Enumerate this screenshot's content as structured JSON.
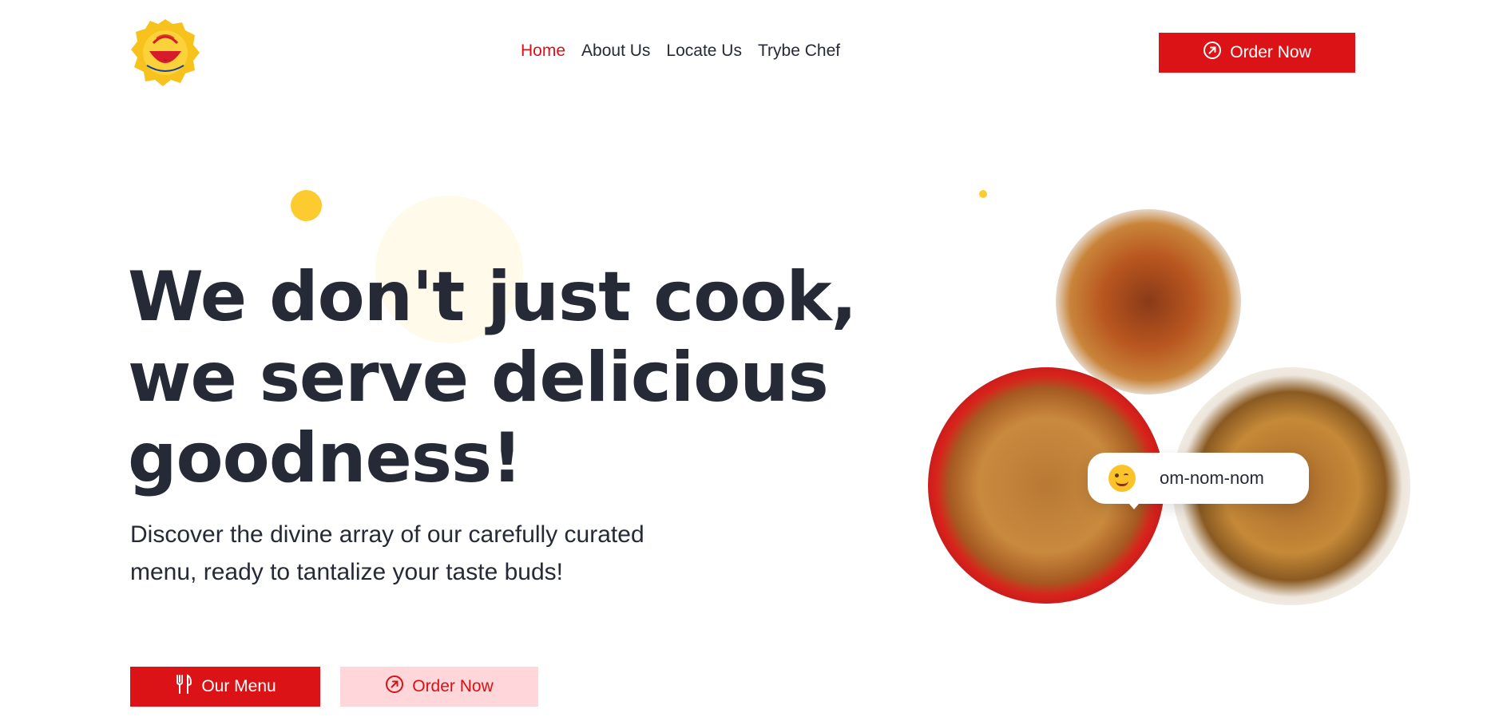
{
  "header": {
    "logo_alt": "Logo",
    "nav": [
      "Home",
      "About Us",
      "Locate Us",
      "Trybe Chef"
    ],
    "order_button": "Order Now"
  },
  "hero": {
    "headline_lines": [
      "We don't just cook,",
      "we serve delicious",
      "goodness!"
    ],
    "subtext": "Discover the divine array of our carefully curated menu, ready to tantalize your taste buds!",
    "buttons": {
      "menu": "Our Menu",
      "order": "Order Now"
    }
  },
  "bubble": {
    "text": "om-nom-nom"
  },
  "colors": {
    "accent_red": "#db1216",
    "accent_yellow": "#fccb2f",
    "dark_text": "#262a36",
    "pink_button": "#ffd6d9"
  }
}
